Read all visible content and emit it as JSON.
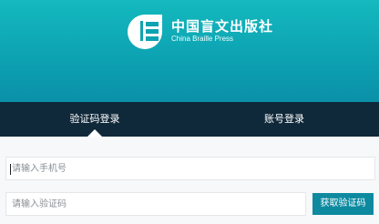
{
  "brand": {
    "name_cn": "中国盲文出版社",
    "name_en": "China Braille Press",
    "logo_icon": "china-braille-press-logo"
  },
  "tabs": [
    {
      "label": "验证码登录",
      "active": true
    },
    {
      "label": "账号登录",
      "active": false
    }
  ],
  "form": {
    "phone_placeholder": "请输入手机号",
    "code_placeholder": "请输入验证码",
    "get_code_label": "获取验证码"
  },
  "colors": {
    "banner": "#0da3b3",
    "tabbar": "#10293a",
    "button": "#0e8aa0"
  }
}
